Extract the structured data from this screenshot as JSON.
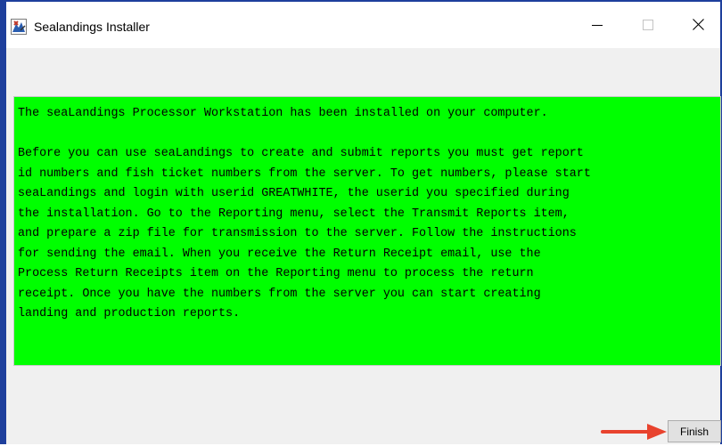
{
  "window": {
    "title": "Sealandings Installer",
    "app_icon": "installer-app-icon",
    "controls": {
      "minimize_icon": "minimize-icon",
      "maximize_icon": "maximize-icon",
      "close_icon": "close-icon"
    }
  },
  "message": {
    "lines": [
      "The seaLandings Processor Workstation has been installed on your computer.",
      "",
      "Before you can use seaLandings to create and submit reports you must get report",
      "id numbers and fish ticket numbers from the server. To get numbers, please start",
      "seaLandings and login with userid GREATWHITE, the userid you specified during",
      "the installation. Go to the Reporting menu, select the Transmit Reports item,",
      "and prepare a zip file for transmission to the server. Follow the instructions",
      "for sending the email. When you receive the Return Receipt email, use the",
      "Process Return Receipts item on the Reporting menu to process the return",
      "receipt. Once you have the numbers from the server you can start creating",
      "landing and production reports."
    ],
    "background_color": "#00ff00"
  },
  "footer": {
    "finish_label": "Finish"
  },
  "annotation": {
    "arrow_icon": "red-arrow-icon",
    "arrow_color": "#e8432e"
  },
  "colors": {
    "window_border": "#1e3f9c",
    "client_background": "#f0f0f0"
  }
}
